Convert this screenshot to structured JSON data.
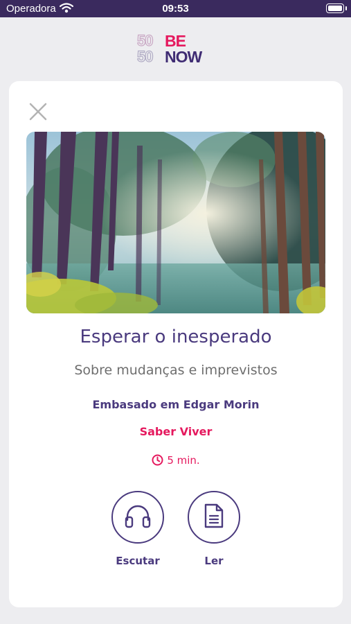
{
  "status_bar": {
    "carrier": "Operadora",
    "time": "09:53"
  },
  "logo": {
    "numbers_top": "50",
    "numbers_bottom": "50",
    "word_top": "BE",
    "word_bottom": "NOW"
  },
  "meditation": {
    "title": "Esperar o inesperado",
    "subtitle": "Sobre mudanças e imprevistos",
    "based_on": "Embasado em Edgar Morin",
    "category": "Saber Viver",
    "duration": "5 min."
  },
  "actions": {
    "listen_label": "Escutar",
    "read_label": "Ler"
  },
  "colors": {
    "primary": "#4a3a7e",
    "accent": "#e5195e",
    "status_bar": "#3a2a5e",
    "background": "#ededf0"
  },
  "icons": {
    "close": "close-icon",
    "listen": "headphones-icon",
    "read": "document-icon",
    "duration": "clock-icon"
  }
}
